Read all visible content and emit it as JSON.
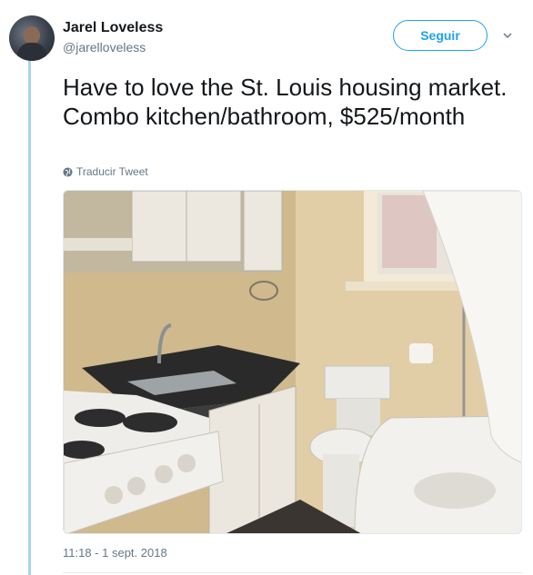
{
  "author": {
    "display_name": "Jarel Loveless",
    "handle": "@jarelloveless"
  },
  "follow_label": "Seguir",
  "tweet": {
    "text": "Have to love the St. Louis housing market. Combo kitchen/bathroom, $525/month",
    "translate_label": "Traducir Tweet",
    "timestamp": "11:18 - 1 sept. 2018"
  },
  "photo": {
    "description_icon": "photo-kitchen-bathroom"
  },
  "colors": {
    "accent": "#1da1f2",
    "thread_line": "#a8d3ee",
    "secondary_text": "#657786"
  }
}
